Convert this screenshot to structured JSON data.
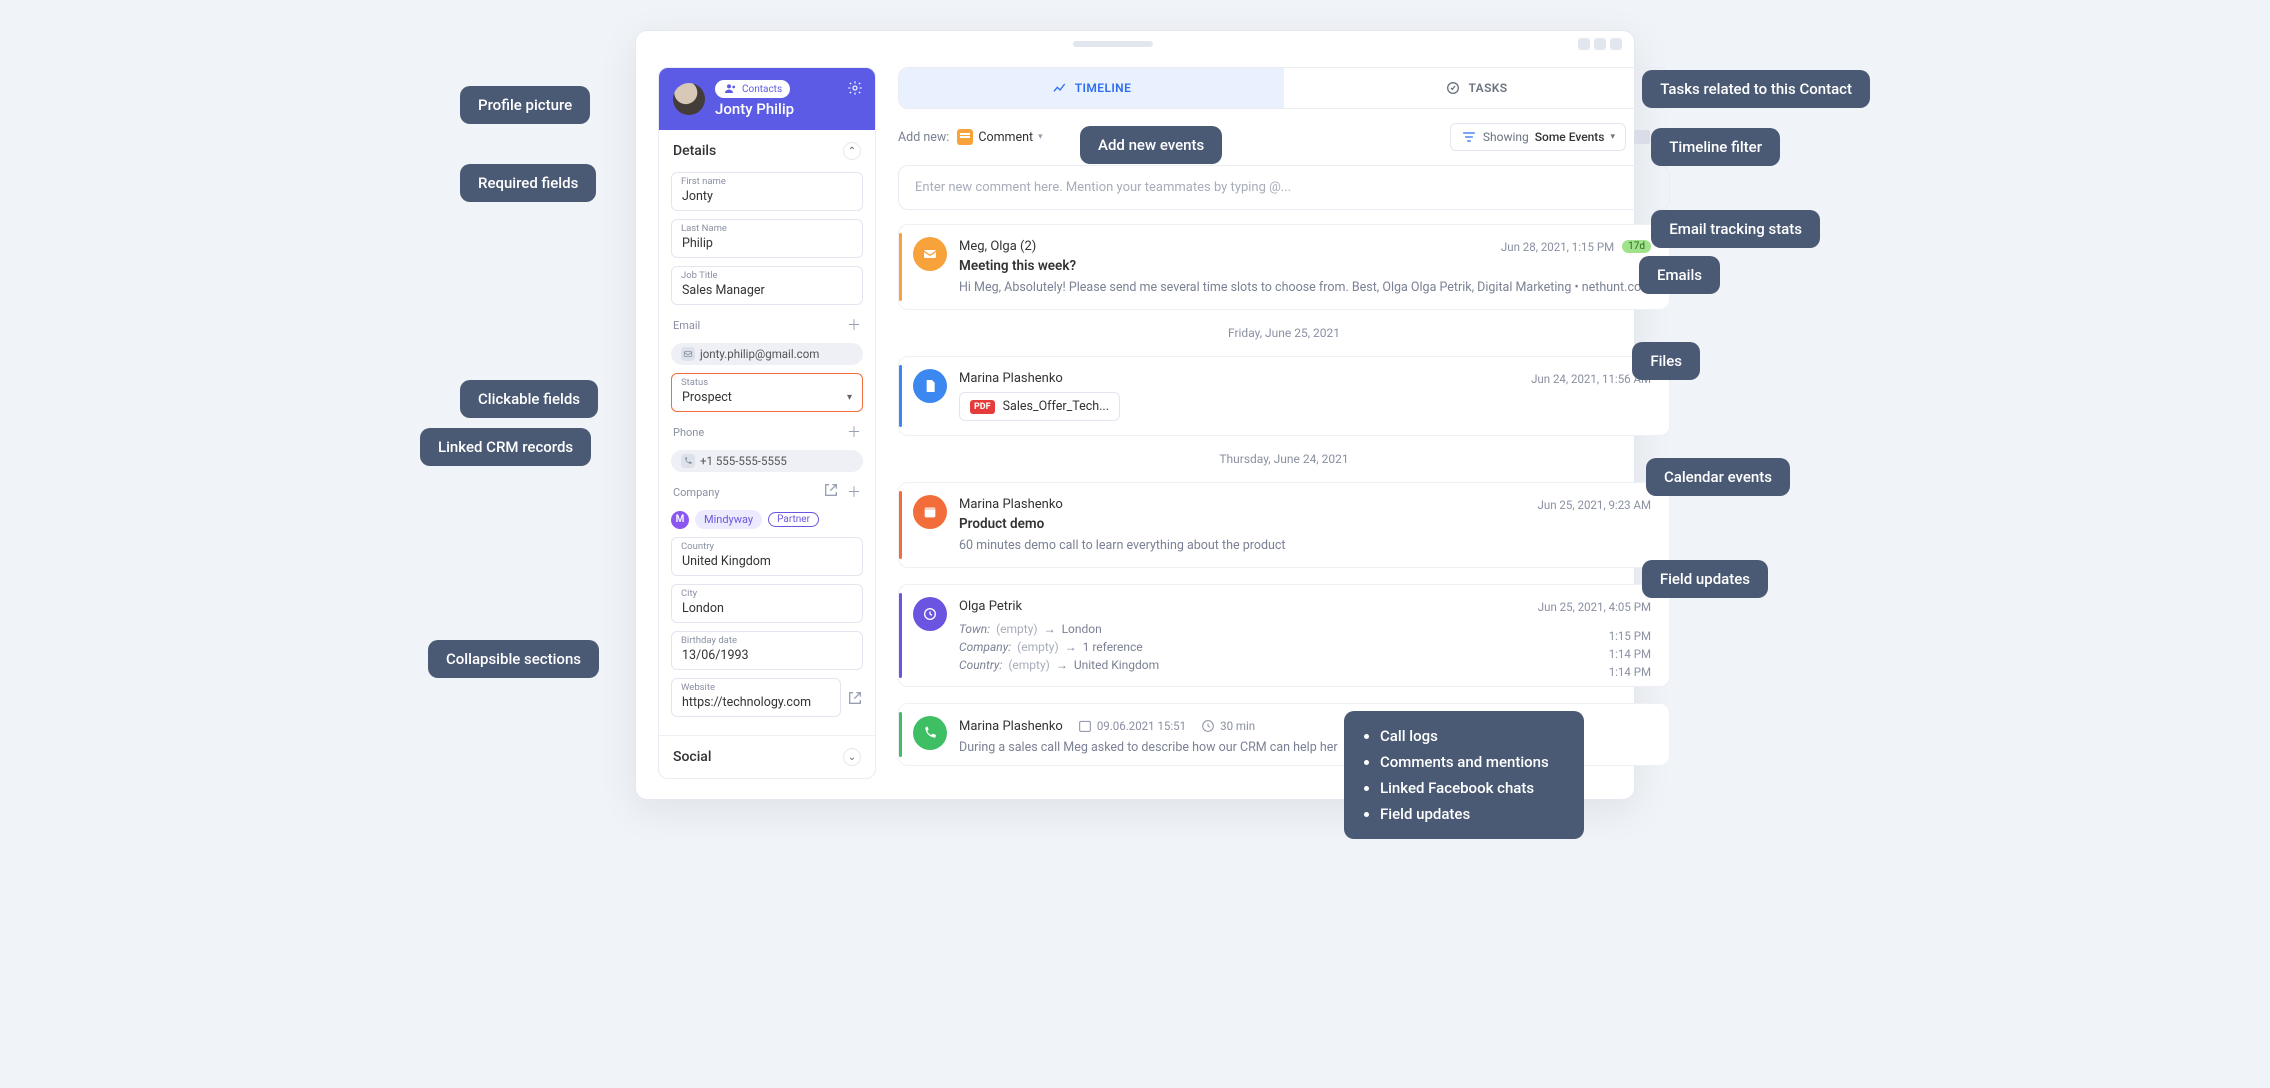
{
  "sidebar": {
    "chip_label": "Contacts",
    "contact_name": "Jonty Philip",
    "details_label": "Details",
    "fields": {
      "first_name": {
        "label": "First name",
        "value": "Jonty"
      },
      "last_name": {
        "label": "Last Name",
        "value": "Philip"
      },
      "job_title": {
        "label": "Job Title",
        "value": "Sales Manager"
      },
      "email": {
        "label": "Email",
        "value": "jonty.philip@gmail.com"
      },
      "status": {
        "label": "Status",
        "value": "Prospect"
      },
      "phone": {
        "label": "Phone",
        "value": "+1 555-555-5555"
      },
      "company": {
        "label": "Company",
        "initial": "M",
        "name": "Mindyway",
        "tag": "Partner"
      },
      "country": {
        "label": "Country",
        "value": "United Kingdom"
      },
      "city": {
        "label": "City",
        "value": "London"
      },
      "birthday": {
        "label": "Birthday date",
        "value": "13/06/1993"
      },
      "website": {
        "label": "Website",
        "value": "https://technology.com"
      }
    },
    "social_label": "Social"
  },
  "tabs": {
    "timeline": "TIMELINE",
    "tasks": "TASKS"
  },
  "toolbar": {
    "add_new": "Add new:",
    "comment": "Comment",
    "showing": "Showing",
    "filter_value": "Some Events"
  },
  "comment_placeholder": "Enter new comment here. Mention your teammates by typing @...",
  "sep1": "Friday, June 25, 2021",
  "sep2": "Thursday, June 24, 2021",
  "cards": {
    "email": {
      "who": "Meg, Olga (2)",
      "when": "Jun 28, 2021, 1:15 PM",
      "badge": "17d",
      "title": "Meeting this week?",
      "snippet": "Hi Meg, Absolutely! Please send me several time slots to choose from. Best, Olga Olga Petrik, Digital Marketing • nethunt.co..."
    },
    "file": {
      "who": "Marina Plashenko",
      "when": "Jun 24, 2021, 11:56 AM",
      "filename": "Sales_Offer_Tech...",
      "filetype": "PDF"
    },
    "cal": {
      "who": "Marina Plashenko",
      "when": "Jun 25, 2021, 9:23 AM",
      "title": "Product demo",
      "snippet": "60 minutes demo call to learn everything about the product"
    },
    "update": {
      "who": "Olga Petrik",
      "when": "Jun 25, 2021, 4:05 PM",
      "rows": [
        {
          "k": "Town:",
          "from": "(empty)",
          "to": "London",
          "t": "1:15 PM"
        },
        {
          "k": "Company:",
          "from": "(empty)",
          "to": "1 reference",
          "t": "1:14 PM"
        },
        {
          "k": "Country:",
          "from": "(empty)",
          "to": "United Kingdom",
          "t": "1:14 PM"
        }
      ]
    },
    "call": {
      "who": "Marina Plashenko",
      "date": "09.06.2021 15:51",
      "dur": "30 min",
      "snippet": "During a sales call Meg asked to describe how our CRM can help her"
    }
  },
  "callouts": {
    "profile_pic": "Profile picture",
    "required": "Required fields",
    "clickable": "Clickable fields",
    "linked": "Linked CRM records",
    "collapsible": "Collapsible sections",
    "add_new": "Add new events",
    "tasks": "Tasks related to this Contact",
    "filter": "Timeline filter",
    "track": "Email tracking stats",
    "emails": "Emails",
    "files": "Files",
    "calevents": "Calendar events",
    "updates": "Field updates"
  },
  "popup": [
    "Call logs",
    "Comments and mentions",
    "Linked Facebook chats",
    "Field updates"
  ]
}
